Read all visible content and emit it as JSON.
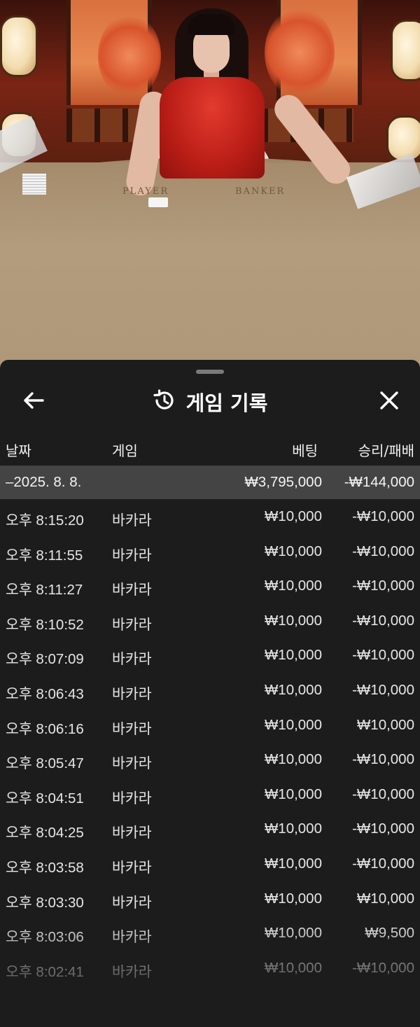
{
  "header": {
    "title": "게임 기록",
    "back_icon": "arrow-left-icon",
    "history_icon": "history-clock-icon",
    "close_icon": "close-icon"
  },
  "video": {
    "table_labels": [
      "PLAYER",
      "BANKER"
    ]
  },
  "columns": {
    "date": "날짜",
    "game": "게임",
    "bet": "베팅",
    "result": "승리/패배"
  },
  "summary": {
    "date": "–2025. 8. 8.",
    "bet": "₩3,795,000",
    "result": "-₩144,000"
  },
  "rows": [
    {
      "time": "오후 8:15:20",
      "game": "바카라",
      "bet": "₩10,000",
      "result": "-₩10,000"
    },
    {
      "time": "오후 8:11:55",
      "game": "바카라",
      "bet": "₩10,000",
      "result": "-₩10,000"
    },
    {
      "time": "오후 8:11:27",
      "game": "바카라",
      "bet": "₩10,000",
      "result": "-₩10,000"
    },
    {
      "time": "오후 8:10:52",
      "game": "바카라",
      "bet": "₩10,000",
      "result": "-₩10,000"
    },
    {
      "time": "오후 8:07:09",
      "game": "바카라",
      "bet": "₩10,000",
      "result": "-₩10,000"
    },
    {
      "time": "오후 8:06:43",
      "game": "바카라",
      "bet": "₩10,000",
      "result": "-₩10,000"
    },
    {
      "time": "오후 8:06:16",
      "game": "바카라",
      "bet": "₩10,000",
      "result": "₩10,000"
    },
    {
      "time": "오후 8:05:47",
      "game": "바카라",
      "bet": "₩10,000",
      "result": "-₩10,000"
    },
    {
      "time": "오후 8:04:51",
      "game": "바카라",
      "bet": "₩10,000",
      "result": "-₩10,000"
    },
    {
      "time": "오후 8:04:25",
      "game": "바카라",
      "bet": "₩10,000",
      "result": "-₩10,000"
    },
    {
      "time": "오후 8:03:58",
      "game": "바카라",
      "bet": "₩10,000",
      "result": "-₩10,000"
    },
    {
      "time": "오후 8:03:30",
      "game": "바카라",
      "bet": "₩10,000",
      "result": "₩10,000"
    },
    {
      "time": "오후 8:03:06",
      "game": "바카라",
      "bet": "₩10,000",
      "result": "₩9,500"
    },
    {
      "time": "오후 8:02:41",
      "game": "바카라",
      "bet": "₩10,000",
      "result": "-₩10,000"
    }
  ],
  "colors": {
    "sheet_bg": "#1c1c1c",
    "summary_bg": "#444444",
    "text": "#e6e6e6"
  }
}
